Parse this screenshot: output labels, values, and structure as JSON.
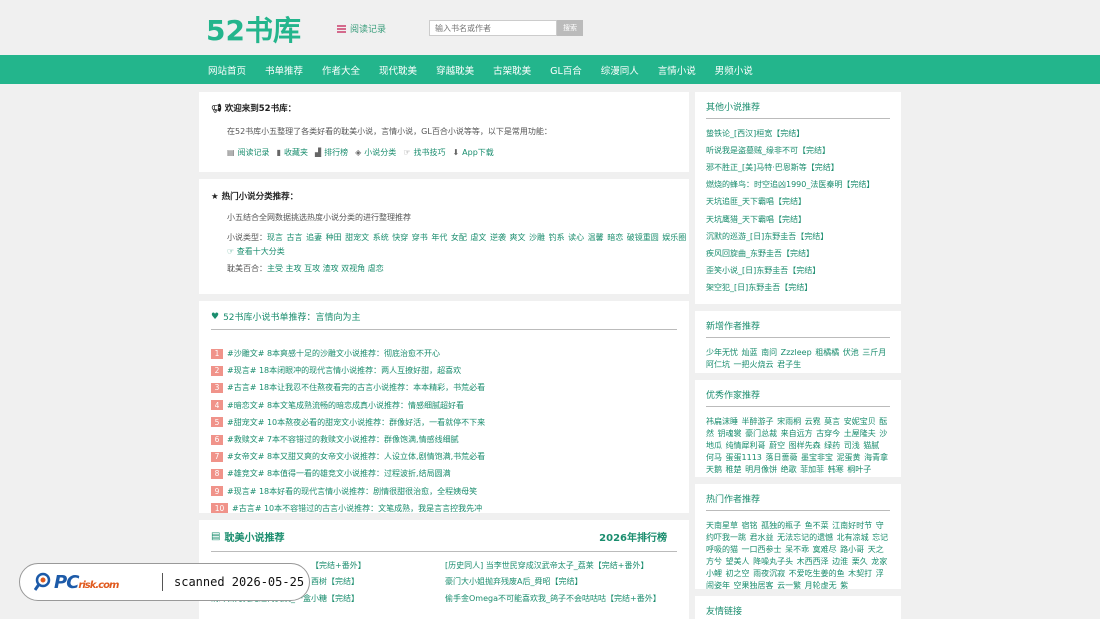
{
  "header": {
    "logo": "52书库",
    "reading_record": "阅读记录",
    "search_placeholder": "输入书名或作者",
    "search_button": "搜索"
  },
  "nav": [
    "网站首页",
    "书单推荐",
    "作者大全",
    "现代耽美",
    "穿越耽美",
    "古架耽美",
    "GL百合",
    "综漫同人",
    "言情小说",
    "男频小说"
  ],
  "welcome": {
    "title": "欢迎来到52书库：",
    "desc": "在52书库小五整理了各类好看的耽美小说，言情小说，GL百合小说等等，以下是常用功能：",
    "links": [
      "阅读记录",
      "收藏夹",
      "排行榜",
      "小说分类",
      "找书技巧",
      "App下载"
    ]
  },
  "hot_categories": {
    "title": "热门小说分类推荐：",
    "intro": "小五结合全网数据挑选热度小说分类的进行整理推荐",
    "type_label": "小说类型：",
    "types": "现言 古言 追妻 种田 甜宠文 系统 快穿 穿书 年代 女配 虐文 逆袭 爽文 沙雕 钓系 读心 温馨 暗恋 破镜重圆 娱乐圈",
    "more": "查看十大分类",
    "danmei_label": "耽美百合：",
    "danmei_types": "主受 主攻 互攻 渣攻 双视角 虐恋"
  },
  "book_rec": {
    "title": "52书库小说书单推荐：言情向为主",
    "items": [
      {
        "num": "1",
        "text": "#沙雕文# 8本爽感十足的沙雕文小说推荐：彻底治愈不开心"
      },
      {
        "num": "2",
        "text": "#现言# 18本闭眼冲的现代言情小说推荐：两人互撩好甜，超喜欢"
      },
      {
        "num": "3",
        "text": "#古言# 18本让我忍不住熬夜看完的古言小说推荐：本本精彩，书荒必看"
      },
      {
        "num": "4",
        "text": "#暗恋文# 8本文笔成熟流畅的暗恋成真小说推荐：情感细腻超好看"
      },
      {
        "num": "5",
        "text": "#甜宠文# 10本熬夜必看的甜宠文小说推荐：群像好活，一看就停不下来"
      },
      {
        "num": "6",
        "text": "#救赎文# 7本不容错过的救赎文小说推荐：群像饱满,情感线细腻"
      },
      {
        "num": "7",
        "text": "#女帝文# 8本又甜又爽的女帝文小说推荐：人设立体,剧情饱满,书荒必看"
      },
      {
        "num": "8",
        "text": "#雄竞文# 8本值得一看的雄竞文小说推荐：过程波折,结局圆满"
      },
      {
        "num": "9",
        "text": "#现言# 18本好看的现代言情小说推荐：剧情很甜很治愈，全程姨母笑"
      },
      {
        "num": "10",
        "text": "#古言# 10本不容错过的古言小说推荐：文笔成熟，我是言言控我先冲"
      }
    ]
  },
  "danmei": {
    "title": "耽美小说推荐",
    "rank": "2026年排行榜",
    "rows": [
      [
        "【完结+番外】",
        "[历史同人] 当李世民穿成汉武帝太子_荔莱【完结+番外】"
      ],
      [
        "酉树【完结】",
        "豪门大小姐抛弃残废A后_舜昭【完结】"
      ],
      [
        "清冷白月光她追悔莫及_一盒小糖【完结】",
        "偷手金Omega不可能喜欢我_鸽子不会咕咕咕【完结+番外】"
      ]
    ]
  },
  "other_novels": {
    "title": "其他小说推荐",
    "items": [
      "蛰铁论_[西汉]桓宽【完结】",
      "听说我是盗墓贼_缘非不可【完结】",
      "邪不胜正_[美]马特·巴恩斯等【完结】",
      "燃烧的蜂鸟：时空追凶1990_法医秦明【完结】",
      "天坑追匪_天下霸唱【完结】",
      "天坑鹰猎_天下霸唱【完结】",
      "沉默的巡游_[日]东野圭吾【完结】",
      "疾风回旋曲_东野圭吾【完结】",
      "歪笑小说_[日]东野圭吾【完结】",
      "架空犯_[日]东野圭吾【完结】"
    ]
  },
  "new_authors": {
    "title": "新增作者推荐",
    "text": "少年无忧 灿蓝 南问 Zzzleep 粗橘橘 伏池 三斤月 阿仁坑 一把火烧云 君子生"
  },
  "good_authors": {
    "title": "优秀作家推荐",
    "text": "祎扁沫睡 半醉游子 宋雨桐 云霓 莫言 安妮宝贝 酝然 钥魂裳 豪门总裁 来自远方 古穿今 土屋隆夫 沙地瓜 纯情犀利哥 蔚空 图样先森 绿药 司浅 猫腻 何马 蛋蛋1113 落日蔷薇 墨宝非宝 泥蛋黄 海青拿天鹅 稚楚 明月像饼 绝歌 菲加菲 韩寒 桐叶子"
  },
  "hot_authors": {
    "title": "热门作者推荐",
    "text": "天南星草 宿铭 孤独的瓶子 鱼不菜 江南好时节 守约吓我一跳 君水益 无法忘记的遗憾 北有凉城 忘记呼吸的猫 一口西参士 呆不乖 寞难尽 路小哥 天之方兮 望美人 降噪丸子头 木西西泽 边淮 栗久 龙家小鲤 初之空 雨夜沉寂 不爱吃生姜的鱼 木契打 浮闹姿年 空果独居客 云一繁 月轮虚无 紫"
  },
  "friend_links": {
    "title": "友情链接"
  },
  "watermark": {
    "logo_main": "PC",
    "logo_sub": "risk.com",
    "scan": "scanned 2026-05-25"
  }
}
